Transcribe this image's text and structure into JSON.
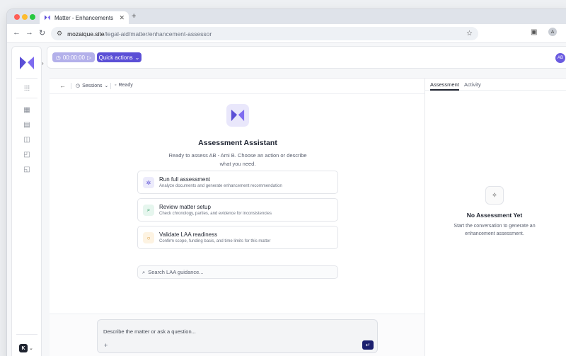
{
  "browser": {
    "tab_title": "Matter - Enhancements",
    "tab_close": "✕",
    "new_tab": "+",
    "url_domain": "mozaique.site",
    "url_path": "/legal-aid/matter/enhancement-assessor",
    "profile_initial": "A"
  },
  "appbar": {
    "timer": "00:00:00",
    "quick_actions": "Quick actions",
    "avatar": "AB"
  },
  "subbar": {
    "sessions": "Sessions",
    "ready": "Ready"
  },
  "hero": {
    "title": "Assessment Assistant",
    "subtitle": "Ready to assess AB - Ami B. Choose an action or describe what you need."
  },
  "actions": [
    {
      "title": "Run full assessment",
      "desc": "Analyze documents and generate enhancement recommendation",
      "icon": "gear-icon"
    },
    {
      "title": "Review matter setup",
      "desc": "Check chronology, parties, and evidence for inconsistencies",
      "icon": "search-icon"
    },
    {
      "title": "Validate LAA readiness",
      "desc": "Confirm scope, funding basis, and time limits for this matter",
      "icon": "circle-icon"
    }
  ],
  "search": {
    "placeholder": "Search LAA guidance..."
  },
  "composer": {
    "placeholder": "Describe the matter or ask a question...",
    "plus": "+",
    "send": "↵"
  },
  "right_panel": {
    "tabs": [
      "Assessment",
      "Activity"
    ],
    "empty_title": "No Assessment Yet",
    "empty_desc": "Start the conversation to generate an enhancement assessment."
  },
  "colors": {
    "accent": "#5b4fd6",
    "timer_bg": "#b3b0ea",
    "send_bg": "#1b1f6e"
  }
}
